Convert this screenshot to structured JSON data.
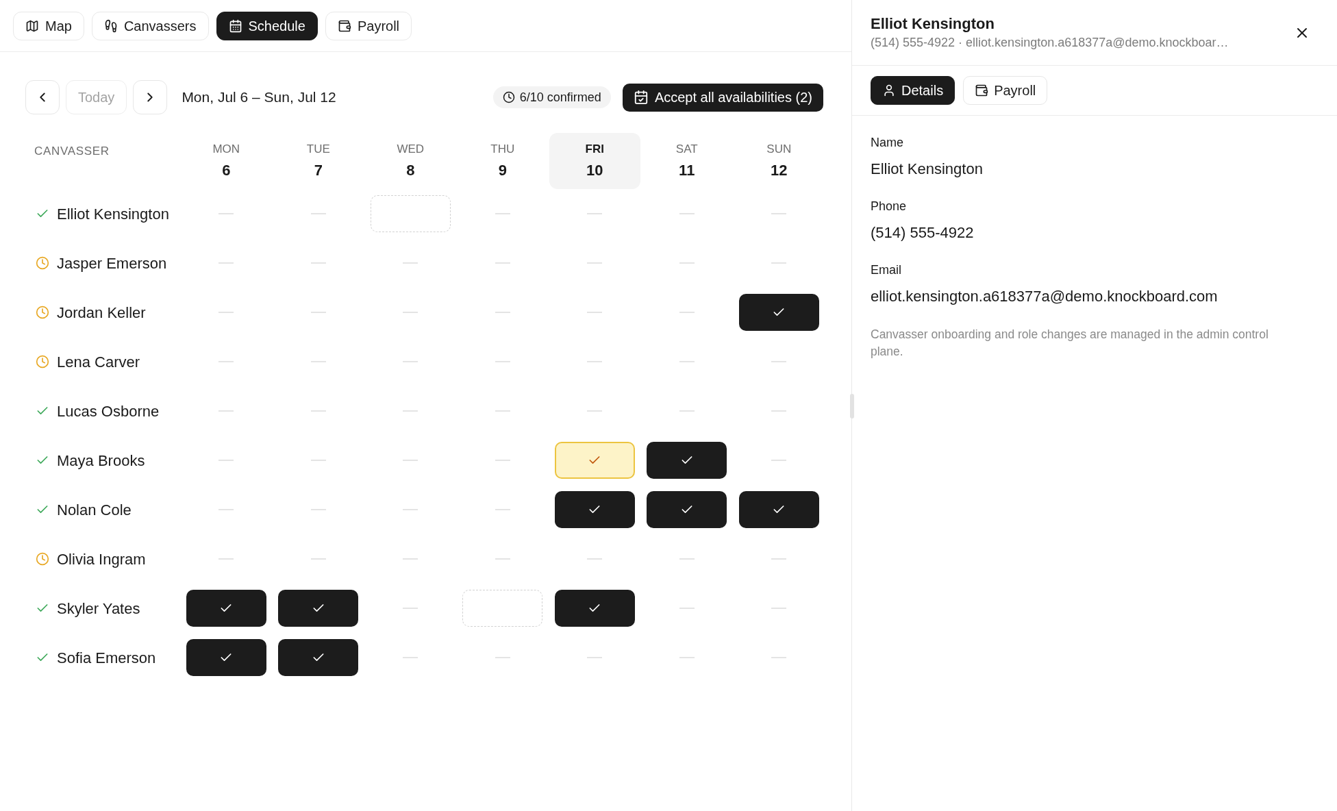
{
  "nav": {
    "tabs": [
      {
        "label": "Map",
        "selected": false
      },
      {
        "label": "Canvassers",
        "selected": false
      },
      {
        "label": "Schedule",
        "selected": true
      },
      {
        "label": "Payroll",
        "selected": false
      }
    ]
  },
  "toolbar": {
    "today": {
      "label": "Today",
      "disabled": true
    },
    "range": "Mon, Jul 6 – Sun, Jul 12",
    "confirmed": "6/10 confirmed",
    "accept": "Accept all availabilities (2)"
  },
  "schedule": {
    "name_header": "CANVASSER",
    "days": [
      {
        "dow": "MON",
        "date": "6",
        "selected": false
      },
      {
        "dow": "TUE",
        "date": "7",
        "selected": false
      },
      {
        "dow": "WED",
        "date": "8",
        "selected": false
      },
      {
        "dow": "THU",
        "date": "9",
        "selected": false
      },
      {
        "dow": "FRI",
        "date": "10",
        "selected": true
      },
      {
        "dow": "SAT",
        "date": "11",
        "selected": false
      },
      {
        "dow": "SUN",
        "date": "12",
        "selected": false
      }
    ],
    "rows": [
      {
        "name": "Elliot Kensington",
        "confirmed": true,
        "cells": [
          {
            "kind": "none"
          },
          {
            "kind": "none"
          },
          {
            "kind": "open"
          },
          {
            "kind": "none"
          },
          {
            "kind": "none"
          },
          {
            "kind": "none"
          },
          {
            "kind": "none"
          }
        ]
      },
      {
        "name": "Jasper Emerson",
        "confirmed": false,
        "cells": [
          {
            "kind": "none"
          },
          {
            "kind": "none"
          },
          {
            "kind": "none"
          },
          {
            "kind": "none"
          },
          {
            "kind": "none"
          },
          {
            "kind": "none"
          },
          {
            "kind": "none"
          }
        ]
      },
      {
        "name": "Jordan Keller",
        "confirmed": false,
        "cells": [
          {
            "kind": "none"
          },
          {
            "kind": "none"
          },
          {
            "kind": "none"
          },
          {
            "kind": "none"
          },
          {
            "kind": "none"
          },
          {
            "kind": "none"
          },
          {
            "kind": "accepted"
          }
        ]
      },
      {
        "name": "Lena Carver",
        "confirmed": false,
        "cells": [
          {
            "kind": "none"
          },
          {
            "kind": "none"
          },
          {
            "kind": "none"
          },
          {
            "kind": "none"
          },
          {
            "kind": "none"
          },
          {
            "kind": "none"
          },
          {
            "kind": "none"
          }
        ]
      },
      {
        "name": "Lucas Osborne",
        "confirmed": true,
        "cells": [
          {
            "kind": "none"
          },
          {
            "kind": "none"
          },
          {
            "kind": "none"
          },
          {
            "kind": "none"
          },
          {
            "kind": "none"
          },
          {
            "kind": "none"
          },
          {
            "kind": "none"
          }
        ]
      },
      {
        "name": "Maya Brooks",
        "confirmed": true,
        "cells": [
          {
            "kind": "none"
          },
          {
            "kind": "none"
          },
          {
            "kind": "none"
          },
          {
            "kind": "none"
          },
          {
            "kind": "pending"
          },
          {
            "kind": "accepted"
          },
          {
            "kind": "none"
          }
        ]
      },
      {
        "name": "Nolan Cole",
        "confirmed": true,
        "cells": [
          {
            "kind": "none"
          },
          {
            "kind": "none"
          },
          {
            "kind": "none"
          },
          {
            "kind": "none"
          },
          {
            "kind": "accepted"
          },
          {
            "kind": "accepted"
          },
          {
            "kind": "accepted"
          }
        ]
      },
      {
        "name": "Olivia Ingram",
        "confirmed": false,
        "cells": [
          {
            "kind": "none"
          },
          {
            "kind": "none"
          },
          {
            "kind": "none"
          },
          {
            "kind": "none"
          },
          {
            "kind": "none"
          },
          {
            "kind": "none"
          },
          {
            "kind": "none"
          }
        ]
      },
      {
        "name": "Skyler Yates",
        "confirmed": true,
        "cells": [
          {
            "kind": "accepted"
          },
          {
            "kind": "accepted"
          },
          {
            "kind": "none"
          },
          {
            "kind": "open"
          },
          {
            "kind": "accepted"
          },
          {
            "kind": "none"
          },
          {
            "kind": "none"
          }
        ]
      },
      {
        "name": "Sofia Emerson",
        "confirmed": true,
        "cells": [
          {
            "kind": "accepted"
          },
          {
            "kind": "accepted"
          },
          {
            "kind": "none"
          },
          {
            "kind": "none"
          },
          {
            "kind": "none"
          },
          {
            "kind": "none"
          },
          {
            "kind": "none"
          }
        ]
      }
    ]
  },
  "detail": {
    "title": "Elliot Kensington",
    "subtitle": "(514) 555-4922 · elliot.kensington.a618377a@demo.knockboar…",
    "tabs": [
      {
        "label": "Details",
        "selected": true
      },
      {
        "label": "Payroll",
        "selected": false
      }
    ],
    "fields": [
      {
        "label": "Name",
        "value": "Elliot Kensington"
      },
      {
        "label": "Phone",
        "value": "(514) 555-4922"
      },
      {
        "label": "Email",
        "value": "elliot.kensington.a618377a@demo.knockboard.com"
      }
    ],
    "note": "Canvasser onboarding and role changes are managed in the admin control plane."
  }
}
